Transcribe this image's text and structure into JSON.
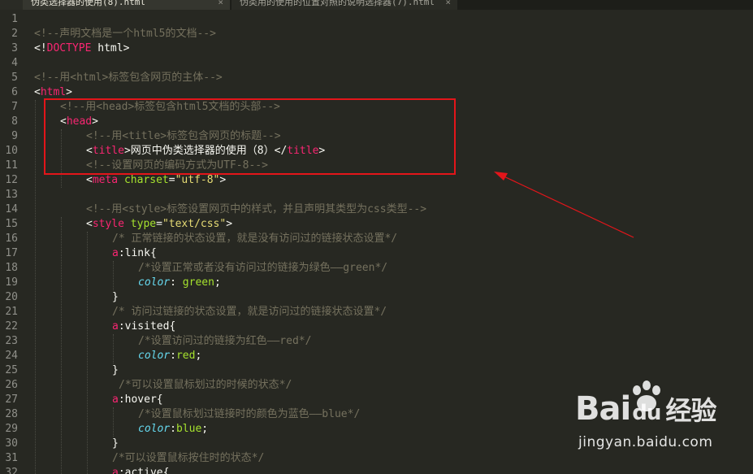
{
  "tabs": [
    {
      "label": ""
    },
    {
      "label": "伪类选择器的使用(8).html"
    },
    {
      "label": "伪类用的使用的位置对照的说明选择器(7).html"
    }
  ],
  "tab_close_glyph": "×",
  "line_numbers": [
    "1",
    "2",
    "3",
    "4",
    "5",
    "6",
    "7",
    "8",
    "9",
    "10",
    "11",
    "12",
    "13",
    "14",
    "15",
    "16",
    "17",
    "18",
    "19",
    "20",
    "21",
    "22",
    "23",
    "24",
    "25",
    "26",
    "27",
    "28",
    "29",
    "30",
    "31",
    "32"
  ],
  "code": {
    "l2": "<!--声明文档是一个html5的文档-->",
    "l3_open": "<!",
    "l3_tag": "DOCTYPE",
    "l3_attr": " html",
    "l3_close": ">",
    "l5": "<!--用<html>标签包含网页的主体-->",
    "l6_open": "<",
    "l6_tag": "html",
    "l6_close": ">",
    "l7": "<!--用<head>标签包含html5文档的头部-->",
    "l8_open": "<",
    "l8_tag": "head",
    "l8_close": ">",
    "l9": "<!--用<title>标签包含网页的标题-->",
    "l10_open": "<",
    "l10_tag": "title",
    "l10_mid": ">",
    "l10_text": "网页中伪类选择器的使用（8）",
    "l10_open2": "</",
    "l10_tag2": "title",
    "l10_close": ">",
    "l11": "<!--设置网页的编码方式为UTF-8-->",
    "l12_open": "<",
    "l12_tag": "meta",
    "l12_attr": " charset",
    "l12_eq": "=",
    "l12_val": "\"utf-8\"",
    "l12_close": ">",
    "l14": "<!--用<style>标签设置网页中的样式，并且声明其类型为css类型-->",
    "l15_open": "<",
    "l15_tag": "style",
    "l15_attr": " type",
    "l15_eq": "=",
    "l15_val": "\"text/css\"",
    "l15_close": ">",
    "l16": "/* 正常链接的状态设置，就是没有访问过的链接状态设置*/",
    "l17_sel": "a",
    "l17_pseudo": ":link{",
    "l18": "/*设置正常或者没有访问过的链接为绿色——green*/",
    "l19_prop": "color",
    "l19_colon": ": ",
    "l19_val": "green",
    "l19_end": ";",
    "l20": "}",
    "l21": "/* 访问过链接的状态设置，就是访问过的链接状态设置*/",
    "l22_sel": "a",
    "l22_pseudo": ":visited{",
    "l23": "/*设置访问过的链接为红色——red*/",
    "l24_prop": "color",
    "l24_colon": ":",
    "l24_val": "red",
    "l24_end": ";",
    "l25": "}",
    "l26": "/*可以设置鼠标划过的时候的状态*/",
    "l27_sel": "a",
    "l27_pseudo": ":hover{",
    "l28": "/*设置鼠标划过链接时的颜色为蓝色——blue*/",
    "l29_prop": "color",
    "l29_colon": ":",
    "l29_val": "blue",
    "l29_end": ";",
    "l30": "}",
    "l31": "/*可以设置鼠标按住时的状态*/",
    "l32_sel": "a",
    "l32_pseudo": ":active{"
  },
  "watermark": {
    "brand_left": "Bai",
    "brand_du": "du",
    "brand_cn": "经验",
    "url": "jingyan.baidu.com"
  },
  "colors": {
    "background": "#272822",
    "comment": "#75715e",
    "tag": "#f92672",
    "attribute": "#a6e22e",
    "string": "#e6db74",
    "property": "#66d9ef",
    "annotation": "#e3151a"
  }
}
